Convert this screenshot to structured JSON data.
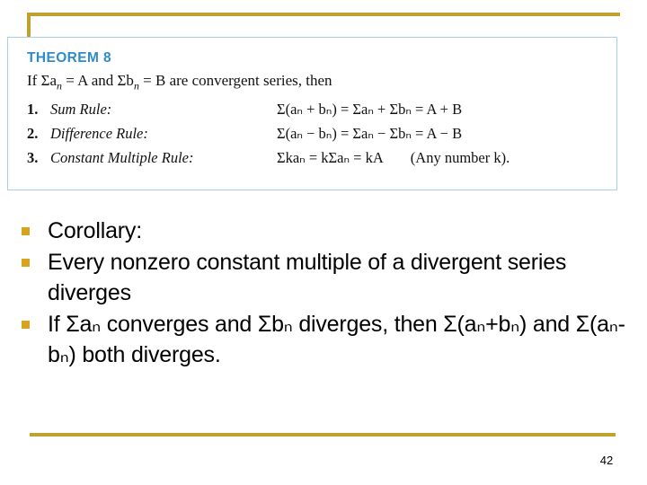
{
  "slide": {
    "page_number": "42",
    "accent_gold": "#bfa12e",
    "bullet_gold": "#d9a41b",
    "theorem_blue": "#2f8bc9",
    "box_border": "#a8cfe8"
  },
  "theorem": {
    "title": "THEOREM 8",
    "intro_plain": "If Σaₙ = A and Σbₙ = B are convergent series, then",
    "intro": {
      "lead": "If ",
      "sum_a": "Σa",
      "sub_n1": "n",
      "eq_a": " = A and ",
      "sum_b": "Σb",
      "sub_n2": "n",
      "eq_b": " = B are convergent series, then"
    },
    "rules": [
      {
        "number": "1.",
        "name": "Sum Rule:",
        "formula_plain": "Σ(aₙ + bₙ) = Σaₙ + Σbₙ = A + B",
        "note": ""
      },
      {
        "number": "2.",
        "name": "Difference Rule:",
        "formula_plain": "Σ(aₙ − bₙ) = Σaₙ − Σbₙ = A − B",
        "note": ""
      },
      {
        "number": "3.",
        "name": "Constant Multiple Rule:",
        "formula_plain": "Σkaₙ = kΣaₙ = kA",
        "note": "(Any number k)."
      }
    ]
  },
  "bullets": [
    {
      "text": "Corollary:"
    },
    {
      "text": "Every nonzero constant multiple of a divergent series diverges"
    },
    {
      "text": "If Σaₙ converges and Σbₙ diverges, then Σ(aₙ+bₙ) and Σ(aₙ- bₙ) both diverges."
    }
  ]
}
